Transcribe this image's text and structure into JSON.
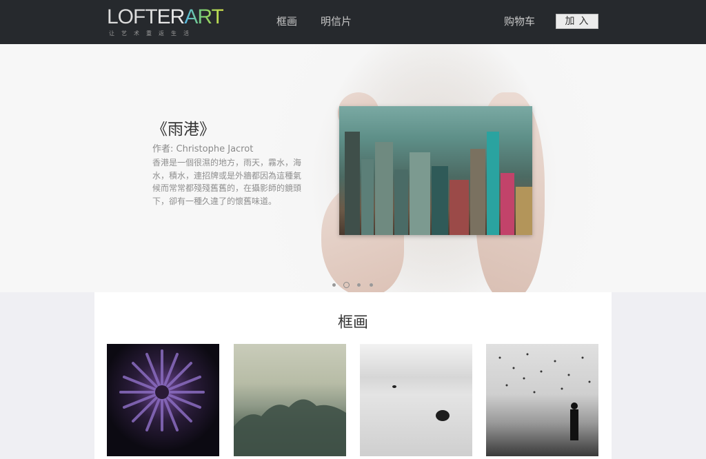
{
  "header": {
    "logo_text_loft": "LOFT",
    "logo_text_er": "ER",
    "logo_text_art": "ART",
    "logo_tagline": "让艺术重返生活",
    "nav": [
      "框画",
      "明信片"
    ],
    "cart_label": "购物车",
    "join_label": "加入"
  },
  "hero": {
    "title": "《雨港》",
    "author": "作者: Christophe Jacrot",
    "description": "香港是一個很濕的地方，雨天，霧水，海水，積水，連招牌或是外牆都因為這種氣候而常常都殘殘舊舊的，在攝影師的鏡頭下，卻有一種久違了的懷舊味道。",
    "slide_count": 4,
    "active_slide": 2
  },
  "section": {
    "title": "框画",
    "items": [
      {
        "name": "purple-chrysanthemum"
      },
      {
        "name": "misty-forest"
      },
      {
        "name": "rocks-in-sea"
      },
      {
        "name": "birds-over-beach"
      }
    ]
  },
  "colors": {
    "header_bg": "#26292d",
    "page_bg": "#efeff3",
    "accent_gradient": [
      "#55b6e8",
      "#7fd06a",
      "#d5e24a"
    ]
  }
}
